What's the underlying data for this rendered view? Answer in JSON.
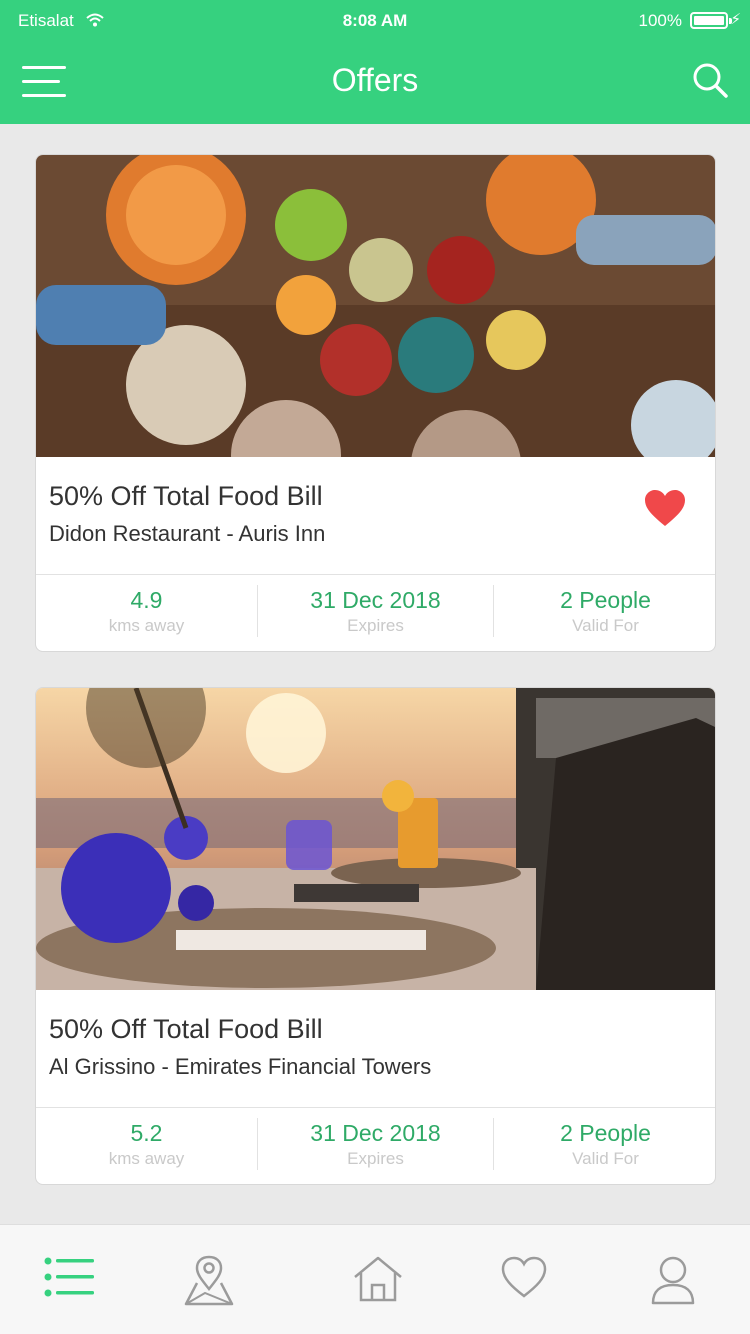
{
  "status_bar": {
    "carrier": "Etisalat",
    "time": "8:08 AM",
    "battery": "100%"
  },
  "header": {
    "title": "Offers",
    "menu_icon": "hamburger-menu-icon",
    "search_icon": "search-icon"
  },
  "offers": [
    {
      "title": "50% Off Total Food Bill",
      "venue": "Didon Restaurant - Auris Inn",
      "favorited": true,
      "distance": "4.9",
      "distance_label": "kms away",
      "expiry": "31 Dec 2018",
      "expiry_label": "Expires",
      "valid": "2 People",
      "valid_label": "Valid For"
    },
    {
      "title": "50% Off Total Food Bill",
      "venue": "Al Grissino - Emirates Financial Towers",
      "favorited": false,
      "distance": "5.2",
      "distance_label": "kms away",
      "expiry": "31 Dec 2018",
      "expiry_label": "Expires",
      "valid": "2 People",
      "valid_label": "Valid For"
    }
  ],
  "tabbar": {
    "active": "list",
    "items": [
      "list-icon",
      "map-pin-icon",
      "home-icon",
      "heart-icon",
      "user-icon"
    ]
  },
  "colors": {
    "brand": "#36d17f",
    "accent_text": "#2faa67",
    "heart": "#f0484a"
  }
}
